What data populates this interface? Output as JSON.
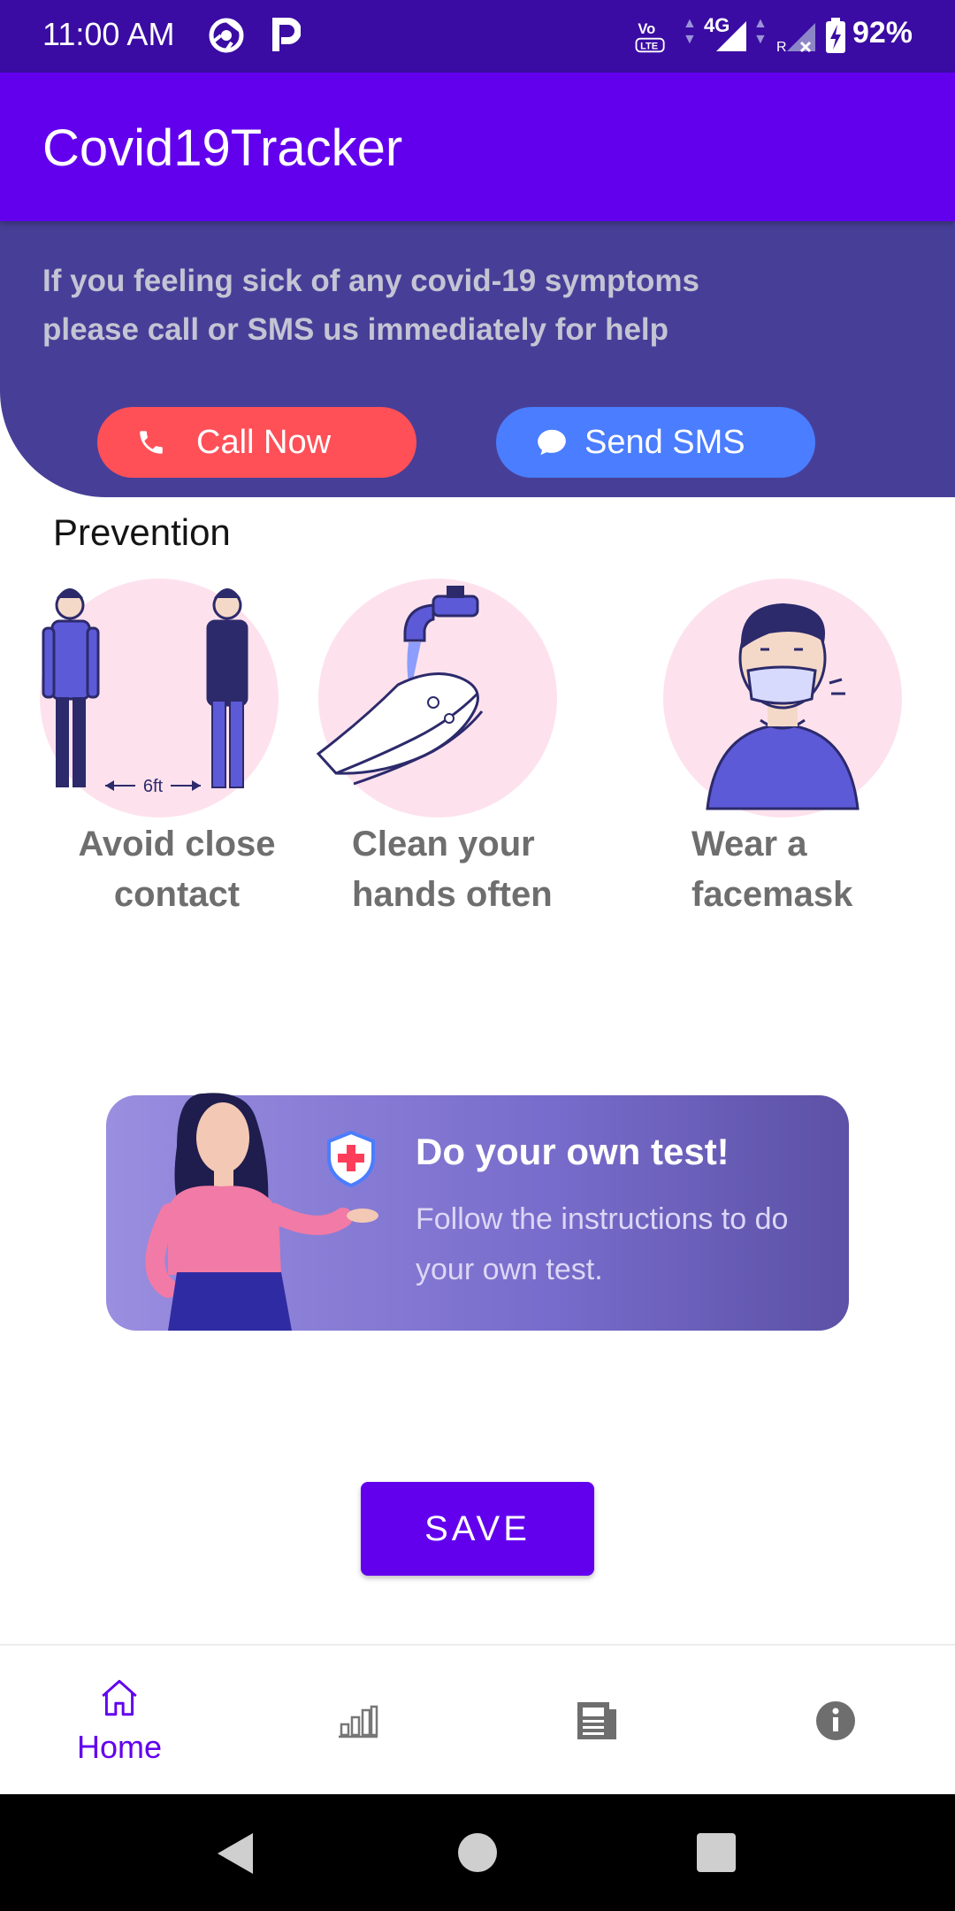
{
  "status_bar": {
    "time": "11:00 AM",
    "network": "4G",
    "battery": "92%",
    "icons": [
      "chrome-icon",
      "p-icon",
      "volte-icon",
      "signal-4g-icon",
      "signal-roaming-icon",
      "battery-charging-icon"
    ]
  },
  "app_bar": {
    "title": "Covid19Tracker"
  },
  "help": {
    "message": "If you feeling sick of any covid-19 symptoms please call or SMS us immediately for help",
    "call_label": "Call Now",
    "sms_label": "Send SMS"
  },
  "prevention": {
    "title": "Prevention",
    "items": [
      {
        "label": "Avoid close contact",
        "icon": "distance-icon",
        "distance_text": "6ft"
      },
      {
        "label": "Clean your hands often",
        "icon": "handwash-icon"
      },
      {
        "label": "Wear a facemask",
        "icon": "facemask-icon"
      }
    ]
  },
  "test_card": {
    "title": "Do your own test!",
    "description": "Follow the instructions to do your own test."
  },
  "save_button": {
    "label": "SAVE"
  },
  "bottom_nav": {
    "items": [
      {
        "label": "Home",
        "icon": "home-icon",
        "selected": true
      },
      {
        "label": "",
        "icon": "stats-icon"
      },
      {
        "label": "",
        "icon": "news-icon"
      },
      {
        "label": "",
        "icon": "info-icon"
      }
    ]
  },
  "colors": {
    "status_bar": "#3a0ca3",
    "primary": "#6200ee",
    "banner": "#473f97",
    "call": "#ff5058",
    "sms": "#4a7dff",
    "circle_bg": "#fde2ee"
  }
}
